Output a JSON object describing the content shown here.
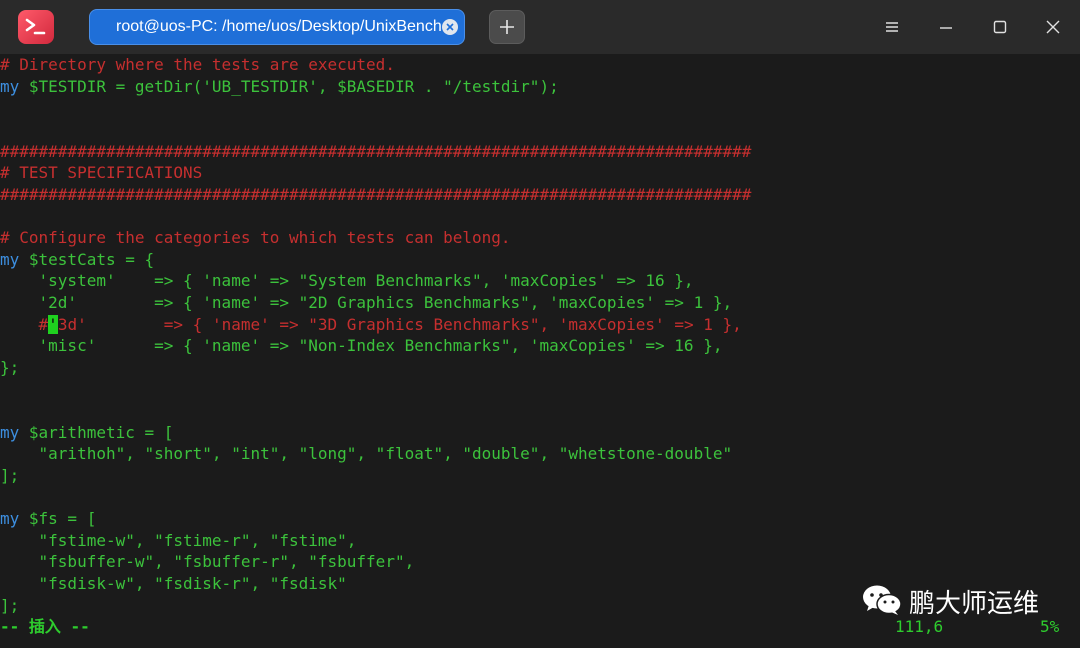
{
  "window": {
    "tab_title": "root@uos-PC: /home/uos/Desktop/UnixBench",
    "icons": [
      "terminal-app-icon",
      "close-icon",
      "plus-icon",
      "menu-icon",
      "minimize-icon",
      "maximize-icon",
      "close-window-icon"
    ]
  },
  "editor": {
    "line01": "# Directory where the tests are executed.",
    "line02_kw": "my",
    "line02_rest": " $TESTDIR = getDir('UB_TESTDIR', $BASEDIR . \"/testdir\");",
    "line05": "##############################################################################",
    "line06": "# TEST SPECIFICATIONS",
    "line07": "##############################################################################",
    "line09": "# Configure the categories to which tests can belong.",
    "line10_kw": "my",
    "line10_var": " $testCats",
    "line10_rest": " = {",
    "line11": "    'system'    => { 'name' => \"System Benchmarks\", 'maxCopies' => 16 },",
    "line12": "    '2d'        => { 'name' => \"2D Graphics Benchmarks\", 'maxCopies' => 1 },",
    "line13_pre": "    #",
    "line13_cursor": "'",
    "line13_post": "3d'        => { 'name' => \"3D Graphics Benchmarks\", 'maxCopies' => 1 },",
    "line14": "    'misc'      => { 'name' => \"Non-Index Benchmarks\", 'maxCopies' => 16 },",
    "line15": "};",
    "line18_kw": "my",
    "line18_var": " $arithmetic",
    "line18_rest": " = [",
    "line19": "    \"arithoh\", \"short\", \"int\", \"long\", \"float\", \"double\", \"whetstone-double\"",
    "line20": "];",
    "line22_kw": "my",
    "line22_var": " $fs",
    "line22_rest": " = [",
    "line23": "    \"fstime-w\", \"fstime-r\", \"fstime\",",
    "line24": "    \"fsbuffer-w\", \"fsbuffer-r\", \"fsbuffer\",",
    "line25": "    \"fsdisk-w\", \"fsdisk-r\", \"fsdisk\"",
    "line26": "];"
  },
  "statusline": {
    "mode": "-- 插入 --",
    "position": "111,6",
    "percent": "5%"
  },
  "watermark": {
    "text": "鹏大师运维",
    "icon": "wechat-icon"
  },
  "colors": {
    "comment": "#c62f2f",
    "keyword": "#3d8fe0",
    "string": "#3cc23c",
    "cursor": "#1fd11f",
    "tab_active": "#1f6fd8"
  }
}
